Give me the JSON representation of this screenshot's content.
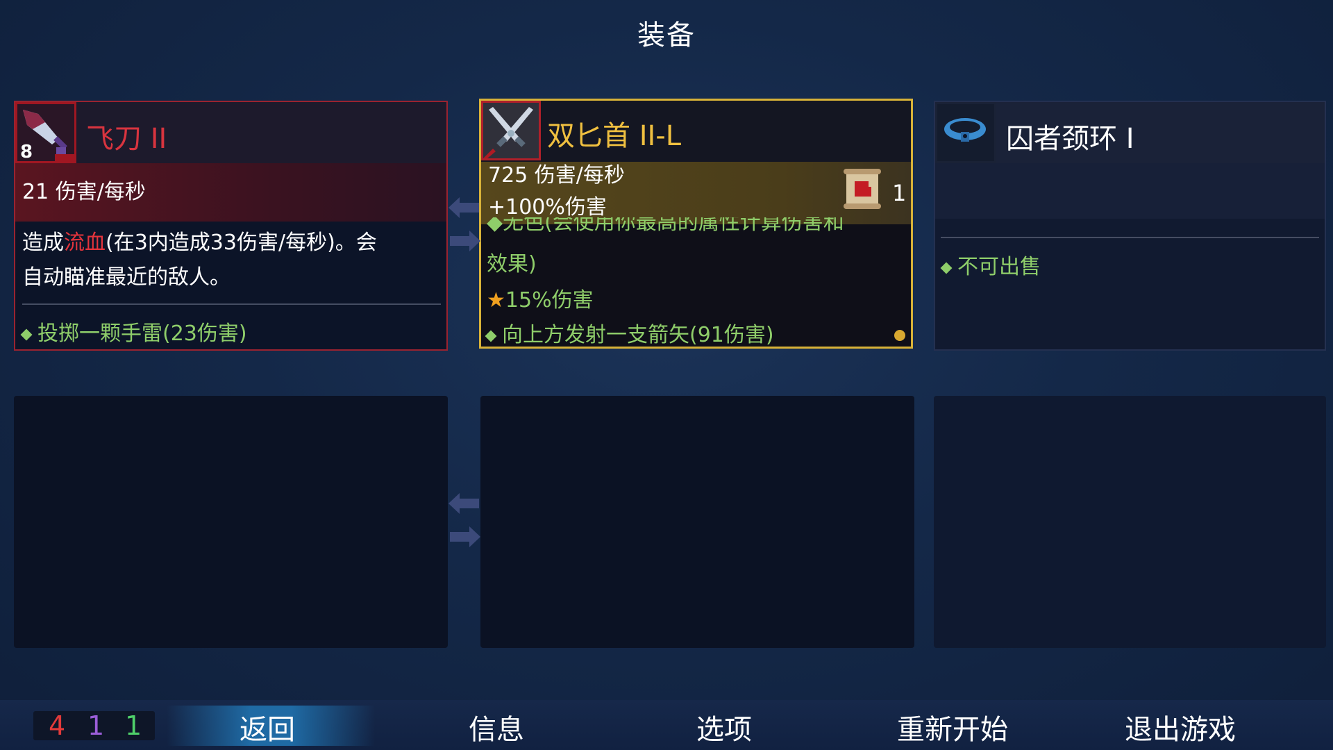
{
  "header": {
    "title": "装备"
  },
  "items": [
    {
      "name": "飞刀 II",
      "level_badge": "8",
      "icon": "throwing-knife-icon",
      "dps": "21 伤害/每秒",
      "desc_prefix": "造成",
      "desc_keyword": "流血",
      "desc_line1_rest": "(在3内造成33伤害/每秒)。会",
      "desc_line2": "自动瞄准最近的敌人。",
      "effect": "投掷一颗手雷(23伤害)"
    },
    {
      "name": "双匕首 II-L",
      "icon": "twin-daggers-icon",
      "dps": "725 伤害/每秒",
      "bonus": "+100%伤害",
      "scroll_icon": "scroll-fist-icon",
      "scroll_count": "1",
      "partial_line": "◆无色(会使用你最高的属性计算伤害和",
      "line_effect": "效果)",
      "star_effect": "15%伤害",
      "effect": "向上方发射一支箭矢(91伤害)"
    },
    {
      "name": "囚者颈环 I",
      "icon": "prisoner-collar-icon",
      "effect": "不可出售"
    }
  ],
  "bottom": {
    "counters": [
      "4",
      "1",
      "1"
    ],
    "menu": [
      "返回",
      "信息",
      "选项",
      "重新开始",
      "退出游戏"
    ]
  },
  "colors": {
    "counter_red": "#e23a3a",
    "counter_purple": "#9b5ed8",
    "counter_green": "#4fd06a",
    "gold": "#f0c040",
    "effect_green": "#8fce6a"
  }
}
